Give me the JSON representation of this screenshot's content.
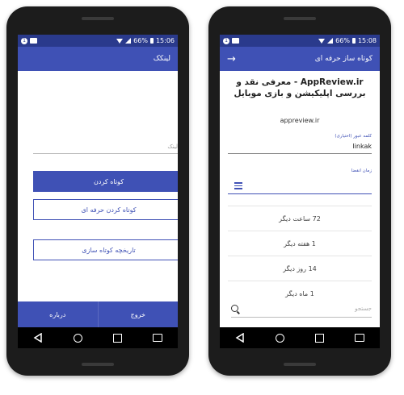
{
  "left": {
    "status": {
      "battery": "66%",
      "time": "15:06"
    },
    "appbar": {
      "title": "لینکک"
    },
    "link_placeholder": "لینک",
    "buttons": {
      "shorten": "کوتاه کردن",
      "pro_shorten": "کوتاه کردن حرفه ای",
      "history": "تاریخچه کوتاه سازی"
    },
    "bottom": {
      "exit": "خروج",
      "about": "درباره"
    }
  },
  "right": {
    "status": {
      "battery": "66%",
      "time": "15:08"
    },
    "appbar": {
      "title": "کوتاه ساز حرفه ای",
      "back_icon": "→"
    },
    "headline": "AppReview.ir - معرفی نقد و بررسی اپلیکیشن و بازی موبایل",
    "domain": "appreview.ir",
    "keyword_label": "کلمه عبور (اختیاری)",
    "keyword_value": "linkak",
    "expiry_label": "زمان انقضا",
    "options": [
      "72 ساعت دیگر",
      "1 هفته دیگر",
      "14 روز دیگر",
      "1 ماه دیگر"
    ],
    "search_placeholder": "جستجو"
  },
  "colors": {
    "primary": "#3f51b5",
    "status": "#2a3a8c"
  }
}
